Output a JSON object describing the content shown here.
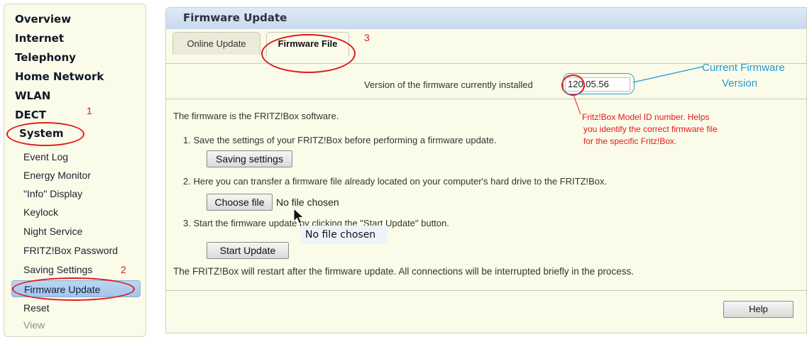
{
  "sidebar": {
    "main_items": [
      {
        "label": "Overview"
      },
      {
        "label": "Internet"
      },
      {
        "label": "Telephony"
      },
      {
        "label": "Home Network"
      },
      {
        "label": "WLAN"
      },
      {
        "label": "DECT"
      },
      {
        "label": "System"
      }
    ],
    "system_items": [
      {
        "label": "Event Log"
      },
      {
        "label": "Energy Monitor"
      },
      {
        "label": "\"Info\" Display"
      },
      {
        "label": "Keylock"
      },
      {
        "label": "Night Service"
      },
      {
        "label": "FRITZ!Box Password"
      },
      {
        "label": "Saving Settings"
      },
      {
        "label": "Firmware Update",
        "selected": true
      },
      {
        "label": "Reset"
      },
      {
        "label": "View"
      }
    ]
  },
  "main": {
    "title": "Firmware Update",
    "tabs": [
      {
        "label": "Online Update",
        "active": false
      },
      {
        "label": "Firmware File",
        "active": true
      }
    ],
    "version_label": "Version of the firmware currently installed",
    "version_value": "120.05.56",
    "intro": "The firmware is the FRITZ!Box software.",
    "step1": "1. Save the settings of your FRITZ!Box before performing a firmware update.",
    "saving_button": "Saving settings",
    "step2": "2. Here you can transfer a firmware file already located on your computer's hard drive to the FRITZ!Box.",
    "choose_file_button": "Choose file",
    "no_file_text": "No file chosen",
    "step3": "3. Start the firmware update by clicking the \"Start Update\" button.",
    "start_button": "Start Update",
    "restart_note": "The FRITZ!Box will restart after the firmware update. All connections will be interrupted briefly in the process.",
    "help_button": "Help",
    "tooltip": "No file chosen"
  },
  "annotations": {
    "num1": "1",
    "num2": "2",
    "num3": "3",
    "current_firmware_line1": "Current Firmware",
    "current_firmware_line2": "Version",
    "model_note_line1": "Fritz!Box Model ID number. Helps",
    "model_note_line2": "you identify the correct firmware file",
    "model_note_line3": "for the specific Fritz!Box.",
    "annotation_red": "#e01a1a",
    "annotation_blue": "#1e9ad8"
  }
}
